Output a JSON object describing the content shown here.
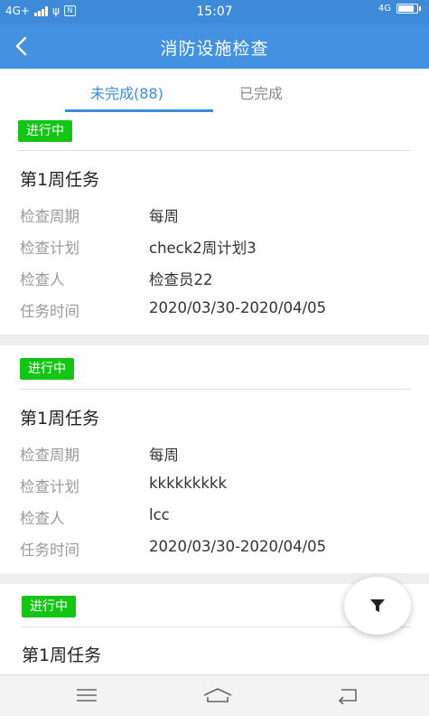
{
  "status": {
    "network": "4G+",
    "time": "15:07",
    "right_network": "4G"
  },
  "nav": {
    "title": "消防设施检查"
  },
  "tabs": {
    "active_label": "未完成(88)",
    "done_label": "已完成"
  },
  "tasks": [
    {
      "badge": "进行中",
      "title": "第1周任务",
      "rows": [
        {
          "label": "检查周期",
          "value": "每周"
        },
        {
          "label": "检查计划",
          "value": "check2周计划3"
        },
        {
          "label": "检查人",
          "value": "检查员22"
        },
        {
          "label": "任务时间",
          "value": "2020/03/30-2020/04/05"
        }
      ]
    },
    {
      "badge": "进行中",
      "title": "第1周任务",
      "rows": [
        {
          "label": "检查周期",
          "value": "每周"
        },
        {
          "label": "检查计划",
          "value": "kkkkkkkkk"
        },
        {
          "label": "检查人",
          "value": "lcc"
        },
        {
          "label": "任务时间",
          "value": "2020/03/30-2020/04/05"
        }
      ]
    },
    {
      "badge": "进行中",
      "title": "第1周任务"
    }
  ],
  "icons": {
    "back": "chevron-left-icon",
    "filter": "filter-icon",
    "menu": "menu-icon",
    "home": "home-icon",
    "back_nav": "back-arrow-icon"
  },
  "colors": {
    "header": "#4391e0",
    "accent": "#3d8ce0",
    "badge": "#15c515"
  }
}
